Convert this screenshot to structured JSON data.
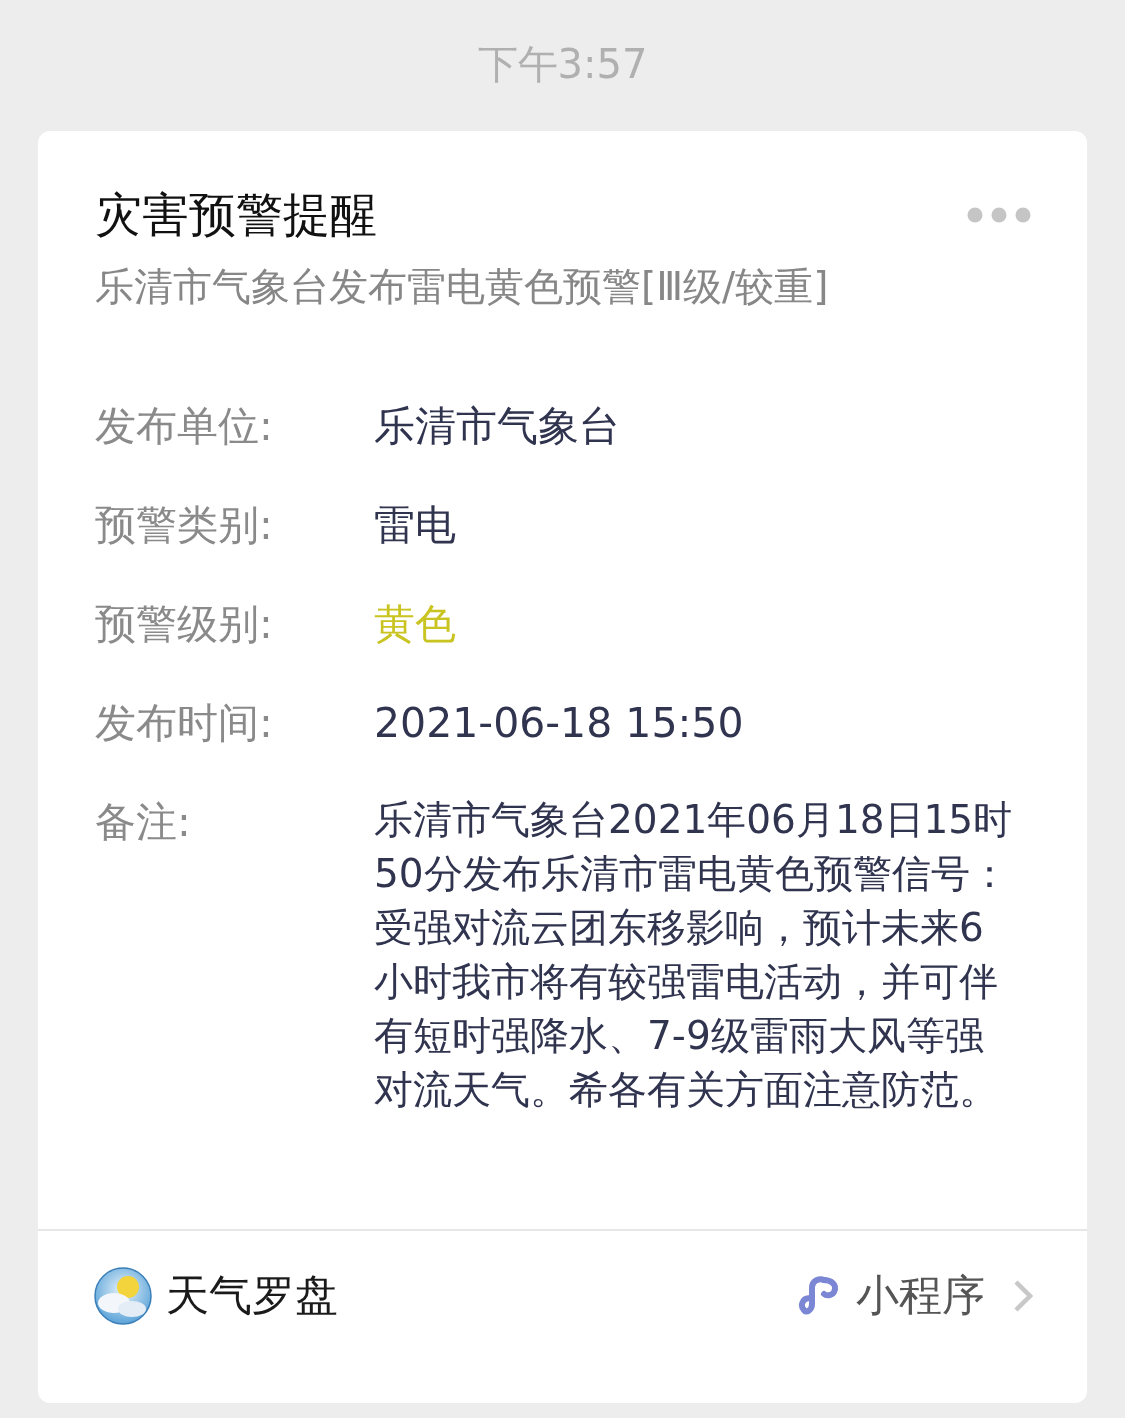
{
  "time": "下午3:57",
  "card": {
    "title": "灾害预警提醒",
    "subtitle": "乐清市气象台发布雷电黄色预警[Ⅲ级/较重]",
    "fields": [
      {
        "label": "发布单位:",
        "value": "乐清市气象台",
        "color": "#30344f"
      },
      {
        "label": "预警类别:",
        "value": "雷电",
        "color": "#30344f"
      },
      {
        "label": "预警级别:",
        "value": "黄色",
        "color": "#c9c421"
      },
      {
        "label": "发布时间:",
        "value": "2021-06-18 15:50",
        "color": "#30344f"
      },
      {
        "label": "备注:",
        "value": "乐清市气象台2021年06月18日15时50分发布乐清市雷电黄色预警信号：受强对流云团东移影响，预计未来6小时我市将有较强雷电活动，并可伴有短时强降水、7-9级雷雨大风等强对流天气。希各有关方面注意防范。",
        "color": "#30344f"
      }
    ],
    "footer": {
      "app_name": "天气罗盘",
      "source": "小程序"
    }
  }
}
